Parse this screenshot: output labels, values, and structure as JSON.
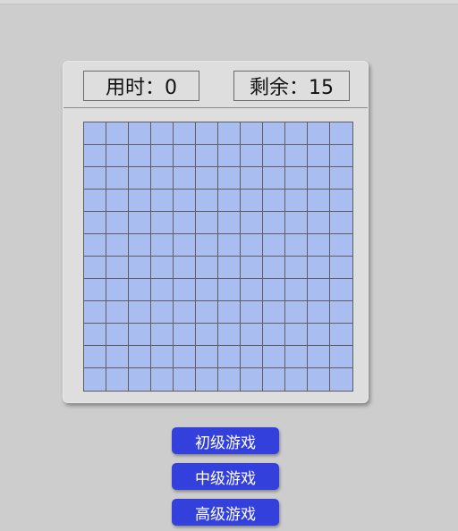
{
  "header": {
    "time_label": "用时：0",
    "remaining_label": "剩余：15"
  },
  "board": {
    "rows": 12,
    "cols": 12,
    "cell_color": "#a9bdf1",
    "grid_color": "#5e5e5e"
  },
  "buttons": {
    "beginner": "初级游戏",
    "intermediate": "中级游戏",
    "advanced": "高级游戏",
    "color": "#3340dc"
  }
}
